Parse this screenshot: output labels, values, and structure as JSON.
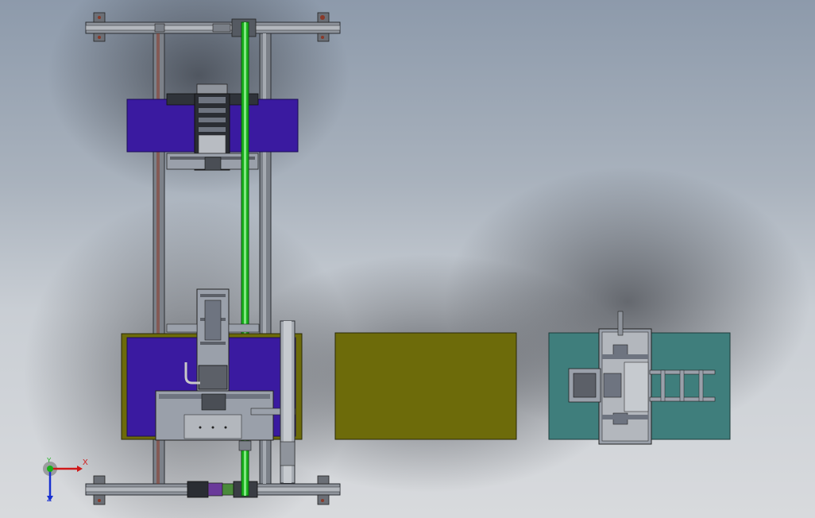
{
  "viewport": {
    "colors": {
      "frame": "#6e7480",
      "frame_light": "#9aa0aa",
      "purple_plate": "#3a1aa0",
      "olive_plate": "#6d6b0a",
      "teal_plate": "#3f7e7c",
      "green_rail": "#19b11c",
      "dark_part": "#2a2d33",
      "bolt": "#8a3a2a"
    }
  },
  "triad": {
    "x_label": "X",
    "y_label": "Y",
    "z_label": "Z",
    "colors": {
      "x": "#d01818",
      "y": "#18b018",
      "z": "#1830d0"
    }
  }
}
